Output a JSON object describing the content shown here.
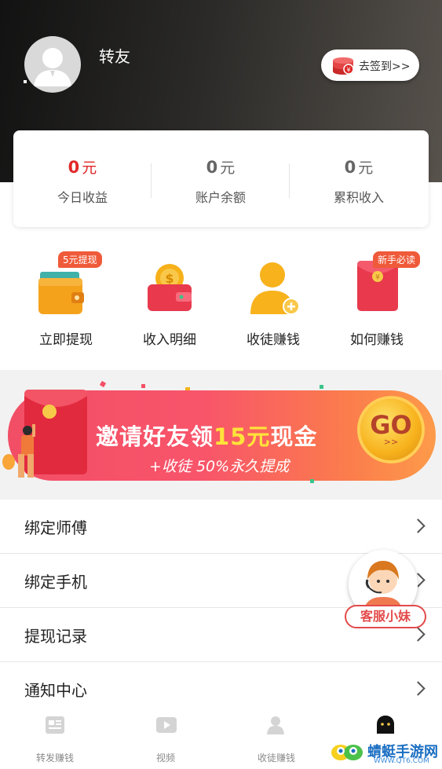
{
  "header": {
    "username": "转友",
    "signin_label": "去签到>>"
  },
  "stats": [
    {
      "value": "0",
      "unit": "元",
      "label": "今日收益",
      "color": "#e02828"
    },
    {
      "value": "0",
      "unit": "元",
      "label": "账户余额",
      "color": "#666666"
    },
    {
      "value": "0",
      "unit": "元",
      "label": "累积收入",
      "color": "#666666"
    }
  ],
  "quick_actions": [
    {
      "label": "立即提现",
      "tag": "5元提现",
      "icon": "wallet-icon"
    },
    {
      "label": "收入明细",
      "tag": "",
      "icon": "coin-wallet-icon"
    },
    {
      "label": "收徒赚钱",
      "tag": "",
      "icon": "add-user-icon"
    },
    {
      "label": "如何赚钱",
      "tag": "新手必读",
      "icon": "red-envelope-icon"
    }
  ],
  "banner": {
    "title_pre": "邀请好友领",
    "title_highlight": "15元",
    "title_post": "现金",
    "subtitle": "+收徒 50%永久提成",
    "go": "GO",
    "go_small": ">>"
  },
  "menu": [
    {
      "label": "绑定师傅"
    },
    {
      "label": "绑定手机"
    },
    {
      "label": "提现记录"
    },
    {
      "label": "通知中心"
    }
  ],
  "float": {
    "label": "客服小妹"
  },
  "tabbar": [
    {
      "label": "转发赚钱",
      "icon": "news-icon"
    },
    {
      "label": "视频",
      "icon": "video-icon"
    },
    {
      "label": "收徒赚钱",
      "icon": "user-icon"
    },
    {
      "label": "",
      "icon": "mine-icon"
    }
  ],
  "watermark": {
    "text": "蜻蜓手游网",
    "url": "WWW.QT6.COM"
  },
  "colors": {
    "accent": "#ef5a3a",
    "banner": "#f24f66",
    "go_gold": "#f7b21c"
  }
}
